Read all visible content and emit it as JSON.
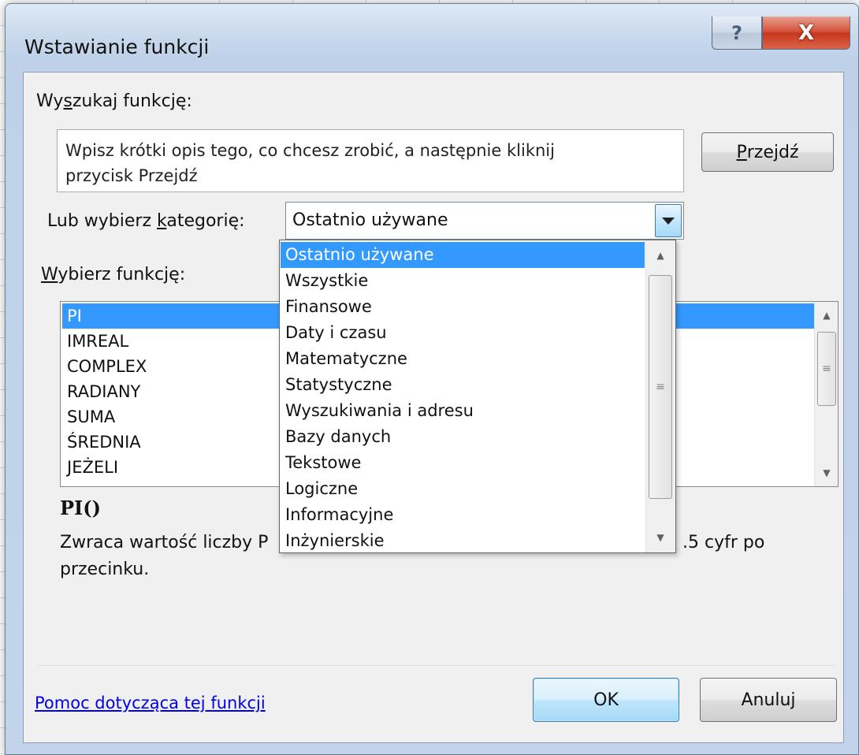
{
  "dialog": {
    "title": "Wstawianie funkcji",
    "help_glyph": "?",
    "close_glyph": "X"
  },
  "search": {
    "label_pre": "Wy",
    "label_acc": "s",
    "label_post": "zukaj funkcję:",
    "value_line1": "Wpisz krótki opis tego, co chcesz zrobić, a następnie kliknij",
    "value_line2": "przycisk Przejdź",
    "go_pre": "",
    "go_acc": "P",
    "go_post": "rzejdź"
  },
  "category": {
    "label_pre": "Lub wybierz ",
    "label_acc": "k",
    "label_post": "ategorię:",
    "selected": "Ostatnio używane",
    "options": [
      "Ostatnio używane",
      "Wszystkie",
      "Finansowe",
      "Daty i czasu",
      "Matematyczne",
      "Statystyczne",
      "Wyszukiwania i adresu",
      "Bazy danych",
      "Tekstowe",
      "Logiczne",
      "Informacyjne",
      "Inżynierskie"
    ]
  },
  "functions": {
    "label_pre": "",
    "label_acc": "W",
    "label_post": "ybierz funkcję:",
    "items": [
      "PI",
      "IMREAL",
      "COMPLEX",
      "RADIANY",
      "SUMA",
      "ŚREDNIA",
      "JEŻELI"
    ],
    "selected": "PI"
  },
  "details": {
    "signature": "PI()",
    "desc_left": "Zwraca wartość liczby P",
    "desc_right": ".5 cyfr po",
    "desc_line2": "przecinku."
  },
  "footer": {
    "help_link": "Pomoc dotycząca tej funkcji",
    "ok": "OK",
    "cancel": "Anuluj"
  },
  "colors": {
    "selection": "#3399ff",
    "link": "#0000ee",
    "close_button": "#c7371c"
  }
}
